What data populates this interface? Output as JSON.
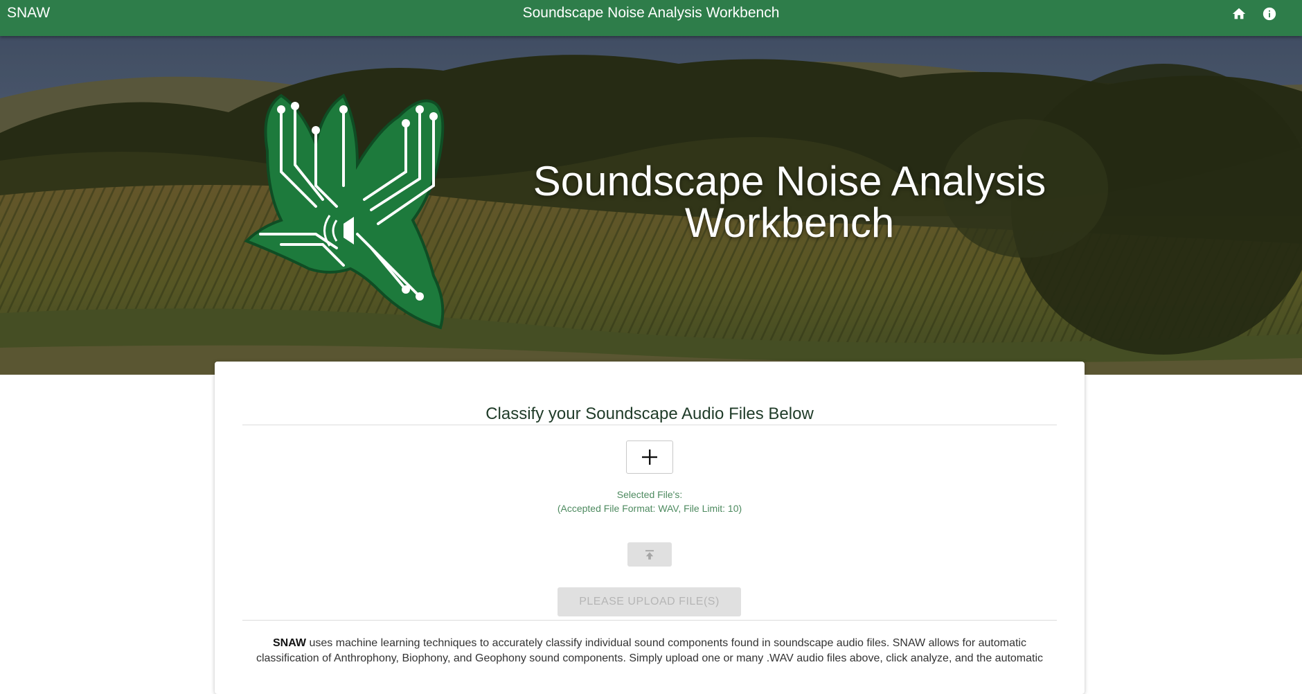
{
  "app_bar": {
    "brand": "SNAW",
    "title": "Soundscape Noise Analysis Workbench",
    "icons": [
      "home-icon",
      "info-icon"
    ]
  },
  "hero": {
    "title": "Soundscape Noise Analysis Workbench",
    "logo": "circuit-bird-logo"
  },
  "classify": {
    "heading": "Classify your Soundscape Audio Files Below",
    "add_icon": "plus-icon",
    "selected_files_label": "Selected File's:",
    "accepted_formats": "(Accepted File Format: WAV, File Limit: 10)",
    "upload_icon": "upload-icon",
    "upload_button": "PLEASE UPLOAD FILE(S)"
  },
  "description": {
    "strong": "SNAW",
    "text": " uses machine learning techniques to accurately classify individual sound components found in soundscape audio files. SNAW allows for automatic classification of Anthrophony, Biophony, and Geophony sound components. Simply upload one or many .WAV audio files above, click analyze, and the automatic"
  },
  "colors": {
    "app_bar": "#2e7d4a",
    "accent_text": "#4d8a5f",
    "disabled_button": "#e0e0e0"
  }
}
